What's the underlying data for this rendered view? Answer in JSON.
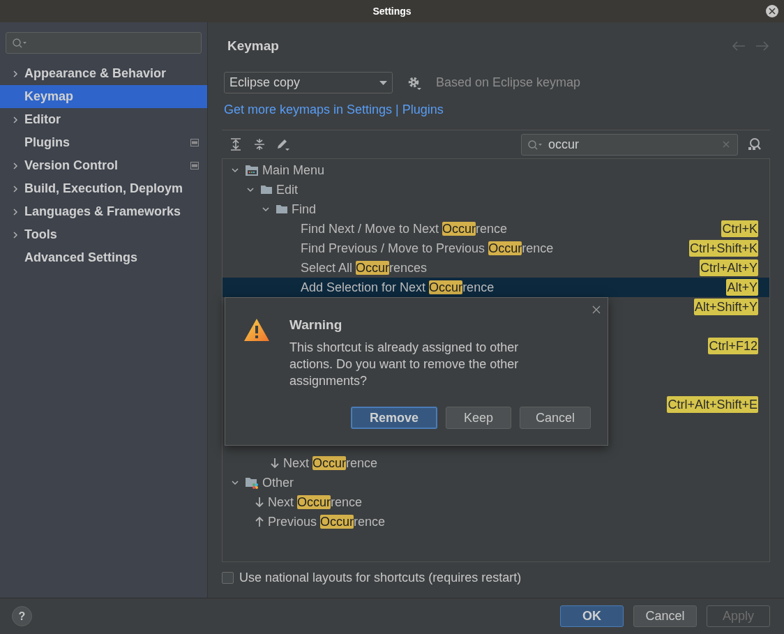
{
  "window": {
    "title": "Settings"
  },
  "sidebar": {
    "items": [
      {
        "label": "Appearance & Behavior",
        "expandable": true,
        "selected": false,
        "badge": false
      },
      {
        "label": "Keymap",
        "expandable": false,
        "selected": true,
        "badge": false
      },
      {
        "label": "Editor",
        "expandable": true,
        "selected": false,
        "badge": false
      },
      {
        "label": "Plugins",
        "expandable": false,
        "selected": false,
        "badge": true
      },
      {
        "label": "Version Control",
        "expandable": true,
        "selected": false,
        "badge": true
      },
      {
        "label": "Build, Execution, Deploym",
        "expandable": true,
        "selected": false,
        "badge": false
      },
      {
        "label": "Languages & Frameworks",
        "expandable": true,
        "selected": false,
        "badge": false
      },
      {
        "label": "Tools",
        "expandable": true,
        "selected": false,
        "badge": false
      },
      {
        "label": "Advanced Settings",
        "expandable": false,
        "selected": false,
        "badge": false
      }
    ]
  },
  "content": {
    "title": "Keymap",
    "keymap": "Eclipse copy",
    "based_on": "Based on Eclipse keymap",
    "link": "Get more keymaps in Settings | Plugins",
    "filter": {
      "value": "occur"
    },
    "tree": [
      {
        "kind": "menu-folder",
        "label_parts": [
          "Main Menu"
        ],
        "selected": false,
        "expanded": true,
        "children": [
          {
            "kind": "folder",
            "label_parts": [
              "Edit"
            ],
            "selected": false,
            "expanded": true,
            "children": [
              {
                "kind": "folder",
                "label_parts": [
                  "Find"
                ],
                "selected": false,
                "expanded": true,
                "children": [
                  {
                    "kind": "action",
                    "label_parts": [
                      "Find Next / Move to Next ",
                      "Occur",
                      "rence"
                    ],
                    "shortcut": "Ctrl+K",
                    "selected": false
                  },
                  {
                    "kind": "action",
                    "label_parts": [
                      "Find Previous / Move to Previous ",
                      "Occur",
                      "rence"
                    ],
                    "shortcut": "Ctrl+Shift+K",
                    "selected": false
                  },
                  {
                    "kind": "action",
                    "label_parts": [
                      "Select All ",
                      "Occur",
                      "rences"
                    ],
                    "shortcut": "Ctrl+Alt+Y",
                    "selected": false
                  },
                  {
                    "kind": "action",
                    "label_parts": [
                      "Add Selection for Next ",
                      "Occur",
                      "rence"
                    ],
                    "shortcut": "Alt+Y",
                    "selected": true
                  },
                  {
                    "kind": "action",
                    "shortcut": "Alt+Shift+Y",
                    "selected": false
                  },
                  {
                    "kind": "action",
                    "shortcut": "Ctrl+F12",
                    "selected": false
                  },
                  {
                    "kind": "action",
                    "shortcut": "Ctrl+Alt+Shift+E",
                    "selected": false
                  }
                ]
              },
              {
                "kind": "arrow-down",
                "label_parts": [
                  "Next ",
                  "Occur",
                  "rence"
                ],
                "selected": false
              }
            ]
          }
        ]
      },
      {
        "kind": "group-folder",
        "label_parts": [
          "Other"
        ],
        "selected": false,
        "expanded": true,
        "children": [
          {
            "kind": "arrow-down",
            "label_parts": [
              "Next ",
              "Occur",
              "rence"
            ],
            "selected": false
          },
          {
            "kind": "arrow-up",
            "label_parts": [
              "Previous ",
              "Occur",
              "rence"
            ],
            "selected": false
          }
        ]
      }
    ],
    "national_layouts": {
      "label": "Use national layouts for shortcuts (requires restart)",
      "checked": false
    }
  },
  "dialog": {
    "title": "Warning",
    "message": "This shortcut is already assigned to other actions. Do you want to remove the other assignments?",
    "buttons": [
      {
        "label": "Remove",
        "default": true
      },
      {
        "label": "Keep",
        "default": false
      },
      {
        "label": "Cancel",
        "default": false
      }
    ]
  },
  "footer": {
    "help": "?",
    "buttons": [
      {
        "label": "OK",
        "default": true,
        "disabled": false
      },
      {
        "label": "Cancel",
        "default": false,
        "disabled": false
      },
      {
        "label": "Apply",
        "default": false,
        "disabled": true
      }
    ]
  }
}
